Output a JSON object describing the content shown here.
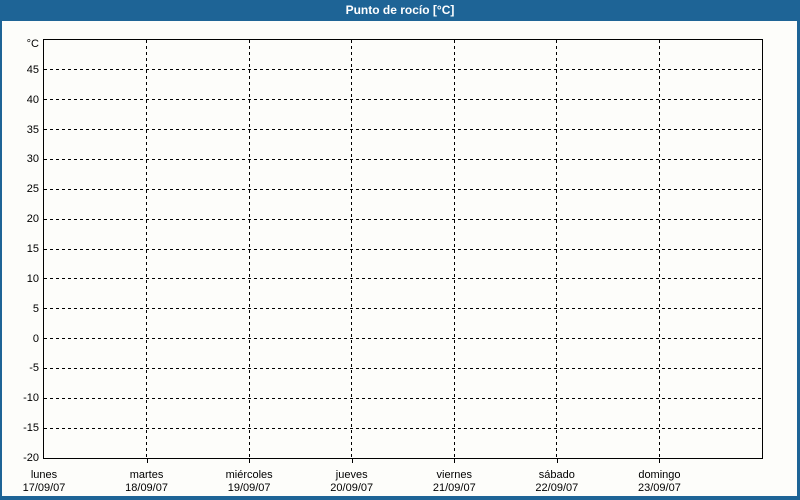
{
  "window": {
    "title": "Punto de rocío [°C]",
    "title_bar_color": "#1e6496",
    "border_color": "#1e6496",
    "content_background": "#fdfdfa",
    "grid_color": "#000000",
    "text_color": "#000000"
  },
  "chart_data": {
    "type": "line",
    "title": "Punto de rocío [°C]",
    "xlabel": "",
    "ylabel": "°C",
    "ylim": [
      -20,
      50
    ],
    "ytick_interval": 5,
    "yticks": [
      45,
      40,
      35,
      30,
      25,
      20,
      15,
      10,
      5,
      0,
      -5,
      -10,
      -15,
      -20
    ],
    "x_categories": [
      {
        "day": "lunes",
        "date": "17/09/07"
      },
      {
        "day": "martes",
        "date": "18/09/07"
      },
      {
        "day": "miércoles",
        "date": "19/09/07"
      },
      {
        "day": "jueves",
        "date": "20/09/07"
      },
      {
        "day": "viernes",
        "date": "21/09/07"
      },
      {
        "day": "sábado",
        "date": "22/09/07"
      },
      {
        "day": "domingo",
        "date": "23/09/07"
      }
    ],
    "series": [],
    "grid": "dashed",
    "legend": "none"
  }
}
